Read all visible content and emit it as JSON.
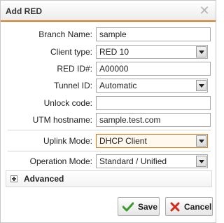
{
  "dialog": {
    "title": "Add RED",
    "close_glyph": "✕"
  },
  "fields": {
    "branch_name": {
      "label": "Branch Name:",
      "value": "sample"
    },
    "client_type": {
      "label": "Client type:",
      "value": "RED 10"
    },
    "red_id": {
      "label": "RED ID#:",
      "value": "A00000"
    },
    "tunnel_id": {
      "label": "Tunnel ID:",
      "value": "Automatic"
    },
    "unlock_code": {
      "label": "Unlock code:",
      "value": ""
    },
    "utm_hostname": {
      "label": "UTM hostname:",
      "value": "sample.test.com"
    },
    "uplink_mode": {
      "label": "Uplink Mode:",
      "value": "DHCP Client"
    },
    "operation_mode": {
      "label": "Operation Mode:",
      "value": "Standard / Unified"
    }
  },
  "advanced": {
    "label": "Advanced"
  },
  "buttons": {
    "save": "Save",
    "cancel": "Cancel"
  },
  "colors": {
    "accent": "#e67817",
    "save_icon": "#3a9a2a",
    "cancel_icon": "#d02a1a"
  },
  "icons": {
    "close": "close-icon",
    "dropdown": "chevron-down-icon",
    "expand": "plus-icon",
    "save": "checkmark-icon",
    "cancel": "x-icon"
  }
}
